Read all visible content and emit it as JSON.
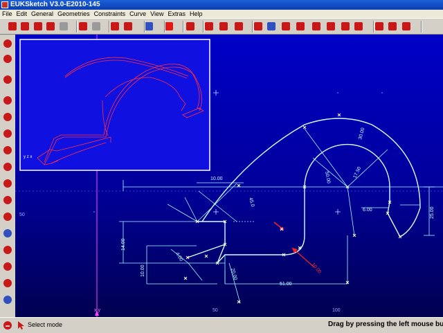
{
  "window": {
    "title": "EUKSketch V3.0-E2010-145"
  },
  "menu": [
    "File",
    "Edit",
    "General",
    "Geometries",
    "Constraints",
    "Curve",
    "View",
    "Extras",
    "Help"
  ],
  "toolbar_icons": [
    {
      "name": "snap-star-icon",
      "color": "#c81818"
    },
    {
      "name": "save-icon",
      "color": "#c81818"
    },
    {
      "name": "stop-icon",
      "color": "#c81818"
    },
    {
      "name": "cube-icon",
      "color": "#c81818"
    },
    {
      "name": "cube-gray-icon",
      "color": "#9a9a9a"
    },
    {
      "name": "eraser-icon",
      "color": "#c81818"
    },
    {
      "name": "eraser-gray-icon",
      "color": "#9a9a9a"
    },
    {
      "name": "grid-icon",
      "color": "#c81818"
    },
    {
      "name": "grid-dots-icon",
      "color": "#c81818"
    },
    {
      "name": "pen-icon",
      "color": "#3050c0"
    },
    {
      "name": "swiss-cross-icon",
      "color": "#e01818"
    },
    {
      "name": "no-entry-icon",
      "color": "#c81818"
    },
    {
      "name": "angle-icon",
      "color": "#c81818"
    },
    {
      "name": "point-icon",
      "color": "#c81818"
    },
    {
      "name": "gear-icon",
      "color": "#c81818"
    },
    {
      "name": "table-icon",
      "color": "#c81818"
    },
    {
      "name": "table-blue-icon",
      "color": "#3050c0"
    },
    {
      "name": "lock-icon",
      "color": "#c81818"
    },
    {
      "name": "lock2-icon",
      "color": "#c81818"
    },
    {
      "name": "no-dim-icon",
      "color": "#c81818"
    },
    {
      "name": "chain-icon",
      "color": "#c81818"
    },
    {
      "name": "bolt-icon",
      "color": "#c81818"
    },
    {
      "name": "hammer-icon",
      "color": "#c81818"
    },
    {
      "name": "zoom-in-icon",
      "color": "#c81818"
    },
    {
      "name": "zoom-out-icon",
      "color": "#c81818"
    },
    {
      "name": "zoom-fit-icon",
      "color": "#c81818"
    }
  ],
  "left_icons": [
    {
      "name": "select-arrow-icon",
      "color": "#c81818"
    },
    {
      "name": "hand-icon",
      "color": "#c81818"
    },
    {
      "name": "axis-icon",
      "color": "#c81818"
    },
    {
      "name": "point-tool-icon",
      "color": "#c81818"
    },
    {
      "name": "line-tool-icon",
      "color": "#c81818"
    },
    {
      "name": "polyline-tool-icon",
      "color": "#c81818"
    },
    {
      "name": "arc-tool-icon",
      "color": "#c81818"
    },
    {
      "name": "circle-tool-icon",
      "color": "#c81818"
    },
    {
      "name": "rectangle-tool-icon",
      "color": "#c81818"
    },
    {
      "name": "fillet-tool-icon",
      "color": "#c81818"
    },
    {
      "name": "trim-tool-icon",
      "color": "#c81818"
    },
    {
      "name": "mirror-tool-icon",
      "color": "#3050c0"
    },
    {
      "name": "offset-tool-icon",
      "color": "#c81818"
    },
    {
      "name": "triangle-tool-icon",
      "color": "#c81818"
    },
    {
      "name": "dimension-tool-icon",
      "color": "#c81818"
    },
    {
      "name": "constraint-tool-icon",
      "color": "#3050c0"
    }
  ],
  "canvas": {
    "axis_labels": {
      "y50": "50",
      "x50": "50",
      "x100": "100",
      "origin": "x y",
      "preview_axes": "y z x"
    },
    "dimensions": {
      "d1": "10.00",
      "d2": "45.0",
      "d3": "50.00",
      "d4": "30.00",
      "d5": "17.50",
      "d6": "6.00",
      "d7": "25.00",
      "d8": "14.00",
      "d9": "10.00",
      "d10": "4.00",
      "d11": "20.00",
      "d12": "51.00",
      "d13": "10.00"
    },
    "colors": {
      "sketch": "#d0ffff",
      "accent": "#ff2020",
      "axis": "#ff40ff",
      "preview_line": "#ff3040"
    }
  },
  "status": {
    "mode": "Select mode",
    "hint": "Drag by pressing the left mouse button"
  }
}
